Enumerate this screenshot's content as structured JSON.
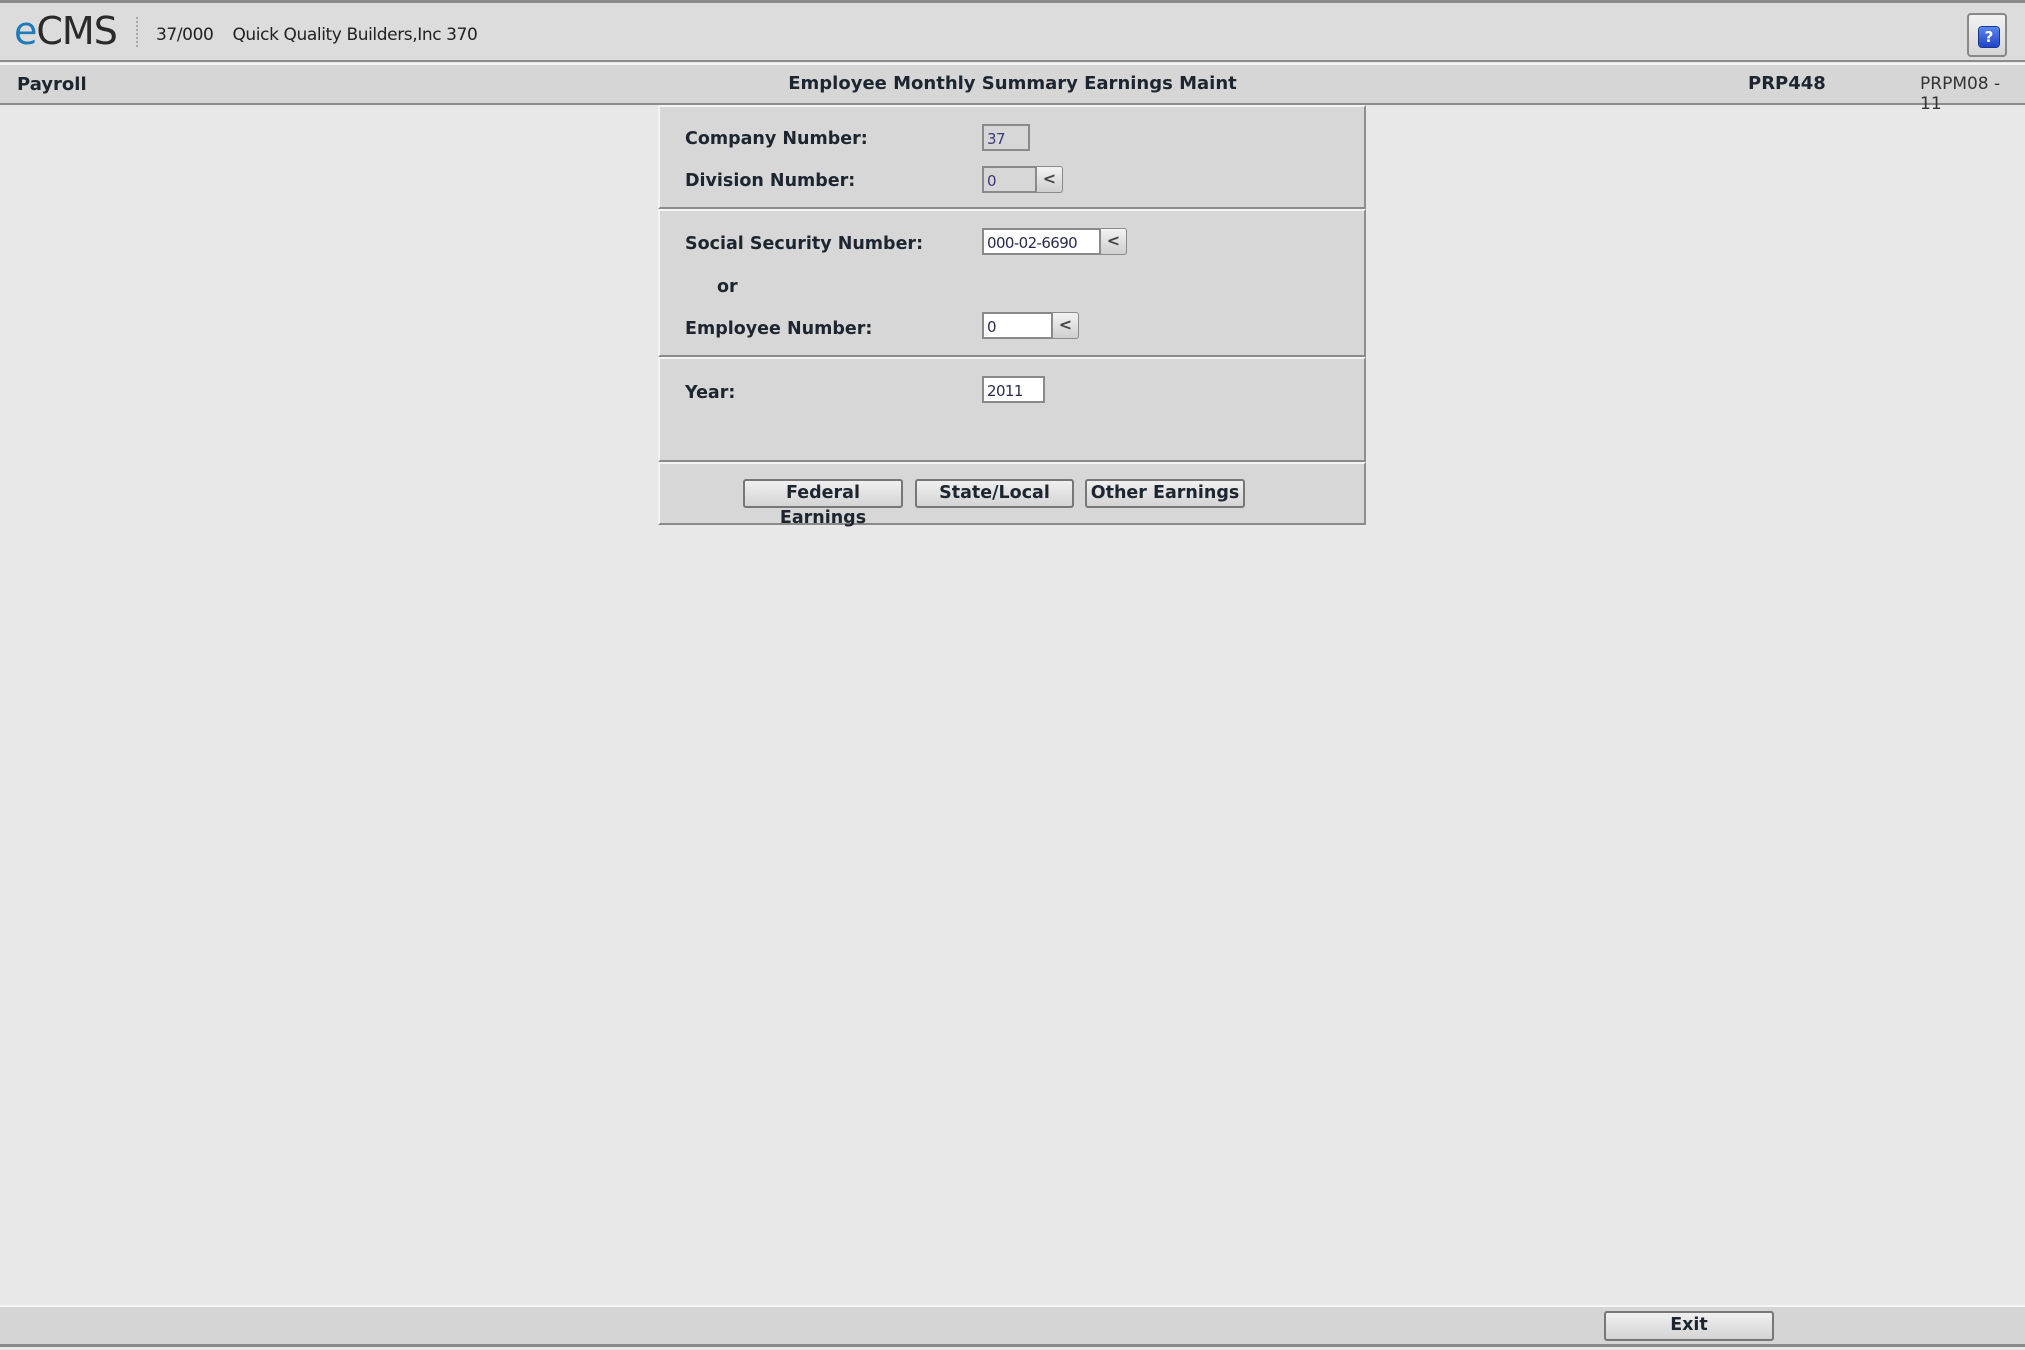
{
  "header": {
    "logo_prefix": "e",
    "logo_suffix": "CMS",
    "company_code": "37/000",
    "company_name": "Quick Quality Builders,Inc 370",
    "help_icon_label": "?"
  },
  "titlebar": {
    "module": "Payroll",
    "screen_title": "Employee Monthly Summary Earnings Maint",
    "program_id": "PRP448",
    "screen_id": "PRPM08 - 11"
  },
  "form": {
    "company_number": {
      "label": "Company Number:",
      "value": "37"
    },
    "division_number": {
      "label": "Division Number:",
      "value": "0",
      "prompt_icon": "<"
    },
    "ssn": {
      "label": "Social Security Number:",
      "value": "000-02-6690",
      "prompt_icon": "<"
    },
    "or_label": "or",
    "employee_number": {
      "label": "Employee Number:",
      "value": "0",
      "prompt_icon": "<"
    },
    "year": {
      "label": "Year:",
      "value": "2011"
    }
  },
  "actions": {
    "federal_earnings": "Federal Earnings",
    "state_local": "State/Local",
    "other_earnings": "Other Earnings"
  },
  "footer": {
    "exit_label": "Exit"
  }
}
